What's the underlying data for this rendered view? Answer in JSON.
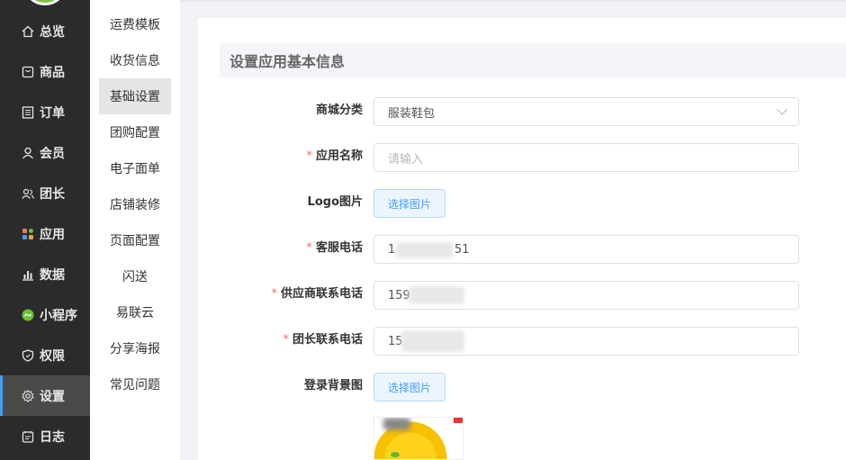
{
  "sidebar": {
    "items": [
      {
        "label": "总览",
        "icon": "home-icon"
      },
      {
        "label": "商品",
        "icon": "product-box-icon"
      },
      {
        "label": "订单",
        "icon": "order-list-icon"
      },
      {
        "label": "会员",
        "icon": "user-icon"
      },
      {
        "label": "团长",
        "icon": "users-icon"
      },
      {
        "label": "应用",
        "icon": "apps-grid-icon"
      },
      {
        "label": "数据",
        "icon": "bar-chart-icon"
      },
      {
        "label": "小程序",
        "icon": "mini-program-icon"
      },
      {
        "label": "权限",
        "icon": "shield-icon"
      },
      {
        "label": "设置",
        "icon": "gear-icon"
      },
      {
        "label": "日志",
        "icon": "log-icon"
      }
    ],
    "active": "设置",
    "colors": {
      "bg": "#2b2b2b",
      "active_bg": "#4a4a4a",
      "accent": "#409eff",
      "logo": "#7cc142"
    }
  },
  "submenu": {
    "items": [
      "运费模板",
      "收货信息",
      "基础设置",
      "团购配置",
      "电子面单",
      "店铺装修",
      "页面配置",
      "闪送",
      "易联云",
      "分享海报",
      "常见问题"
    ],
    "active": "基础设置"
  },
  "form": {
    "section_title": "设置应用基本信息",
    "category": {
      "label": "商城分类",
      "value": "服装鞋包"
    },
    "app_name": {
      "label": "应用名称",
      "placeholder": "请输入"
    },
    "logo": {
      "label": "Logo图片",
      "button": "选择图片"
    },
    "service_phone": {
      "label": "客服电话",
      "value_prefix": "1",
      "value_suffix": "51"
    },
    "supplier_phone": {
      "label": "供应商联系电话",
      "value_prefix": "159"
    },
    "leader_phone": {
      "label": "团长联系电话",
      "value_prefix": "15"
    },
    "login_bg": {
      "label": "登录背景图",
      "button": "选择图片"
    },
    "required_mark": "*"
  }
}
